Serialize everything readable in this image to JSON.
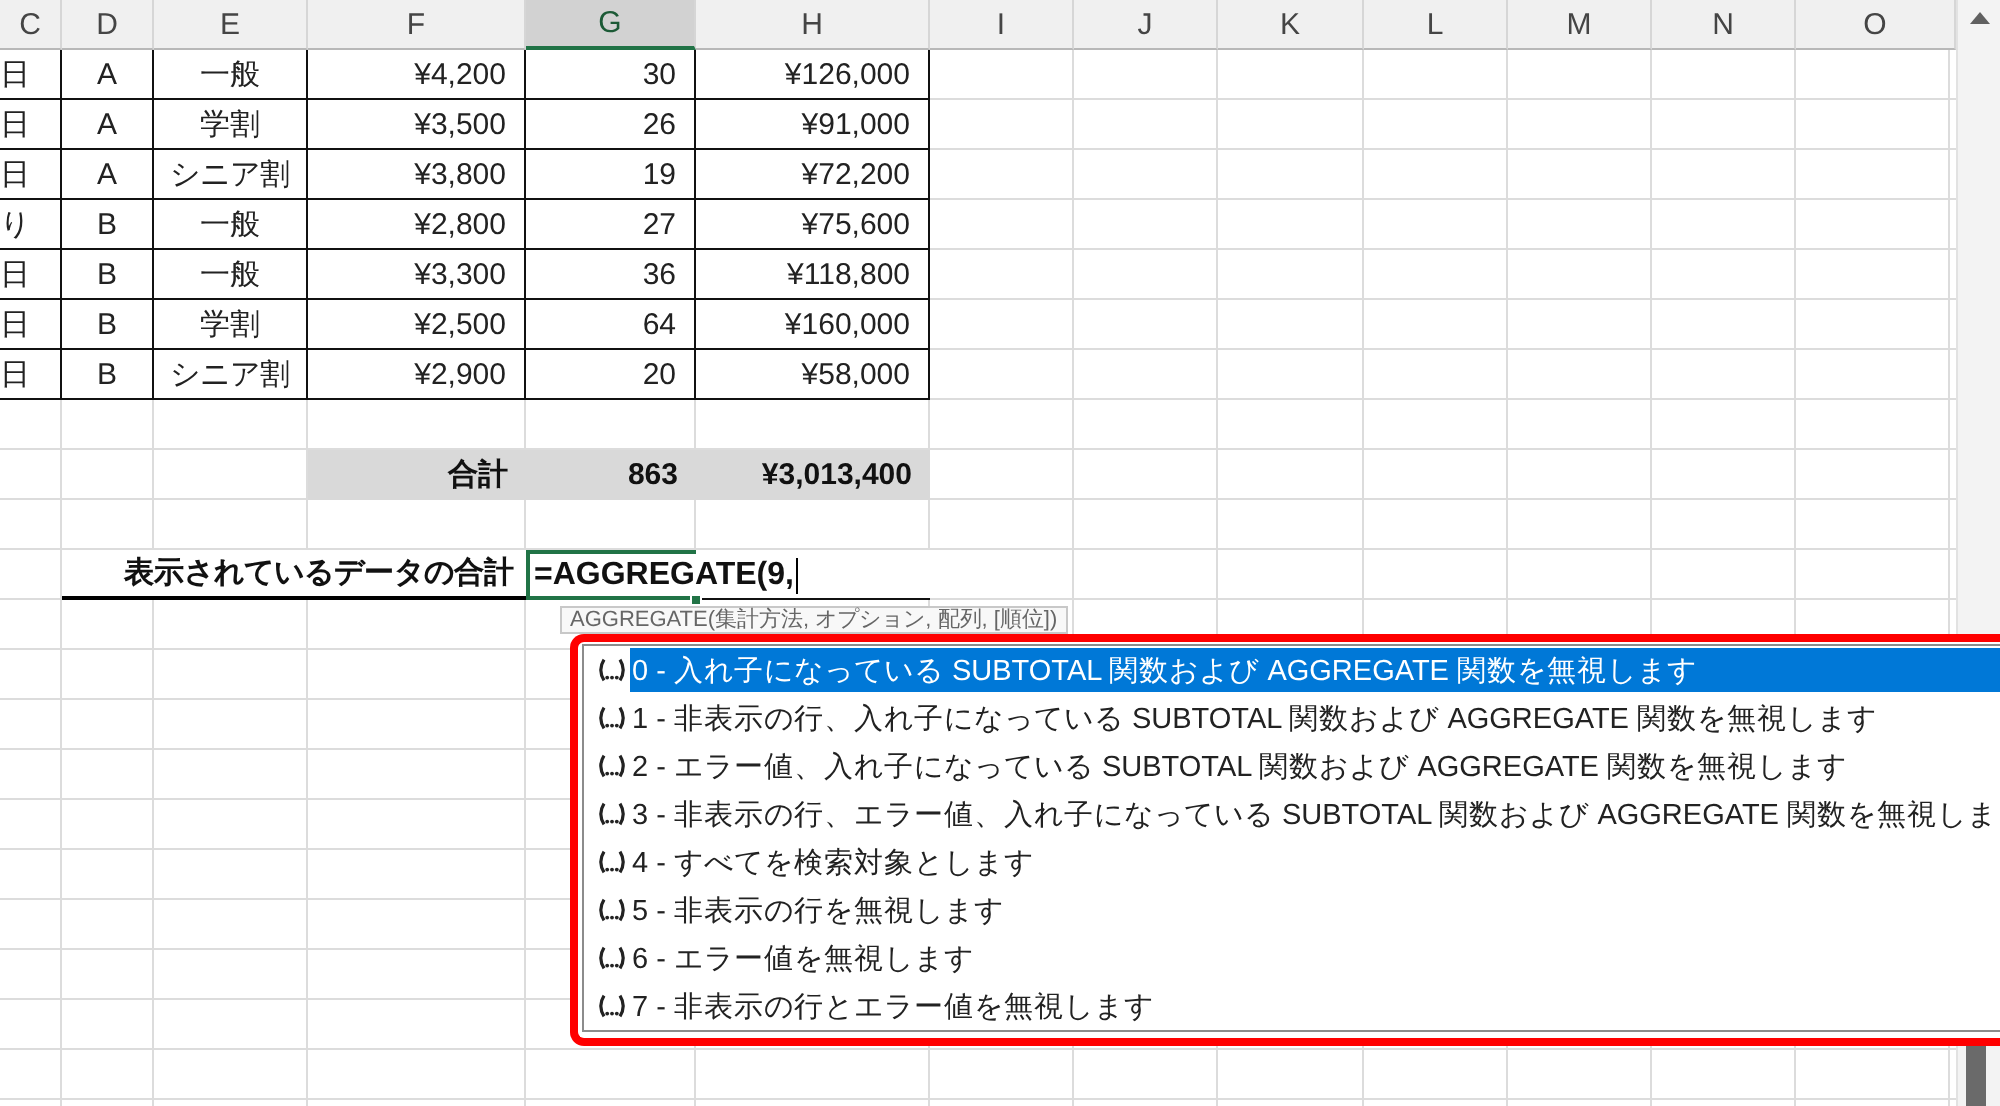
{
  "columns": [
    {
      "label": "C",
      "selected": false
    },
    {
      "label": "D",
      "selected": false
    },
    {
      "label": "E",
      "selected": false
    },
    {
      "label": "F",
      "selected": false
    },
    {
      "label": "G",
      "selected": true
    },
    {
      "label": "H",
      "selected": false
    },
    {
      "label": "I",
      "selected": false
    },
    {
      "label": "J",
      "selected": false
    },
    {
      "label": "K",
      "selected": false
    },
    {
      "label": "L",
      "selected": false
    },
    {
      "label": "M",
      "selected": false
    },
    {
      "label": "N",
      "selected": false
    },
    {
      "label": "O",
      "selected": false
    }
  ],
  "table": {
    "rows": [
      [
        "日",
        "A",
        "一般",
        "¥4,200",
        "30",
        "¥126,000"
      ],
      [
        "日",
        "A",
        "学割",
        "¥3,500",
        "26",
        "¥91,000"
      ],
      [
        "日",
        "A",
        "シニア割",
        "¥3,800",
        "19",
        "¥72,200"
      ],
      [
        "り",
        "B",
        "一般",
        "¥2,800",
        "27",
        "¥75,600"
      ],
      [
        "日",
        "B",
        "一般",
        "¥3,300",
        "36",
        "¥118,800"
      ],
      [
        "日",
        "B",
        "学割",
        "¥2,500",
        "64",
        "¥160,000"
      ],
      [
        "日",
        "B",
        "シニア割",
        "¥2,900",
        "20",
        "¥58,000"
      ]
    ]
  },
  "total_row": {
    "label": "合計",
    "count": "863",
    "amount": "¥3,013,400"
  },
  "formula_row": {
    "label": "表示されているデータの合計",
    "formula": "=AGGREGATE(9,"
  },
  "tooltip": {
    "text": "AGGREGATE(集計方法, オプション, 配列, [順位])"
  },
  "autocomplete": {
    "items": [
      {
        "text": "0 - 入れ子になっている SUBTOTAL 関数および AGGREGATE 関数を無視します",
        "selected": true
      },
      {
        "text": "1 - 非表示の行、入れ子になっている SUBTOTAL 関数および AGGREGATE 関数を無視します",
        "selected": false
      },
      {
        "text": "2 - エラー値、入れ子になっている SUBTOTAL 関数および AGGREGATE 関数を無視します",
        "selected": false
      },
      {
        "text": "3 - 非表示の行、エラー値、入れ子になっている SUBTOTAL 関数および AGGREGATE 関数を無視しま",
        "selected": false
      },
      {
        "text": "4 - すべてを検索対象とします",
        "selected": false
      },
      {
        "text": "5 - 非表示の行を無視します",
        "selected": false
      },
      {
        "text": "6 - エラー値を無視します",
        "selected": false
      },
      {
        "text": "7 - 非表示の行とエラー値を無視します",
        "selected": false
      }
    ]
  }
}
